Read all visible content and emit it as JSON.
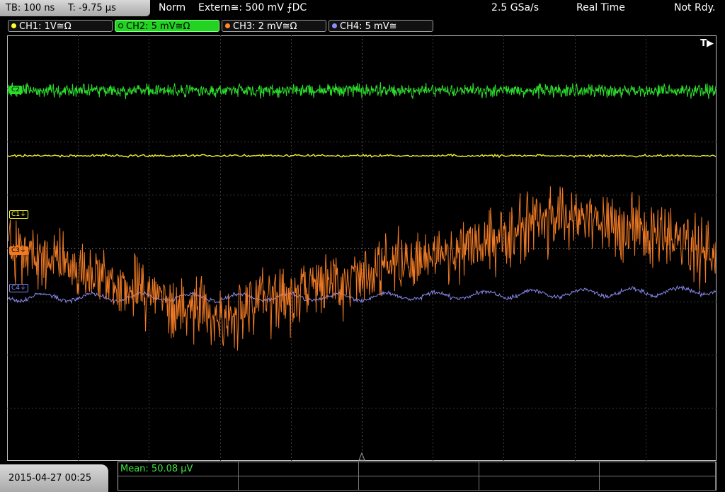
{
  "header": {
    "timebase": "TB: 100 ns",
    "trigger_time": "T: -9.75 µs",
    "mode": "Norm",
    "trigger_source": "Extern≅: 500 mV ⨍DC",
    "sample_rate": "2.5 GSa/s",
    "acq_mode": "Real Time",
    "status": "Not Rdy."
  },
  "channels": [
    {
      "label": "CH1: 1V≅Ω",
      "color": "#ffff33",
      "active": false
    },
    {
      "label": "CH2: 5 mV≅Ω",
      "color": "#33dd33",
      "active": true
    },
    {
      "label": "CH3: 2 mV≅Ω",
      "color": "#ff8a2a",
      "active": false
    },
    {
      "label": "CH4: 5 mV≅",
      "color": "#8c8cff",
      "active": false
    }
  ],
  "markers": {
    "c1": "C1⏚",
    "c2": "C2",
    "c3": "C3⏚",
    "c4": "C4⏚",
    "trigger": "T▶"
  },
  "footer": {
    "datetime": "2015-04-27 00:25",
    "measurement": "Mean: 50.08 µV"
  }
}
